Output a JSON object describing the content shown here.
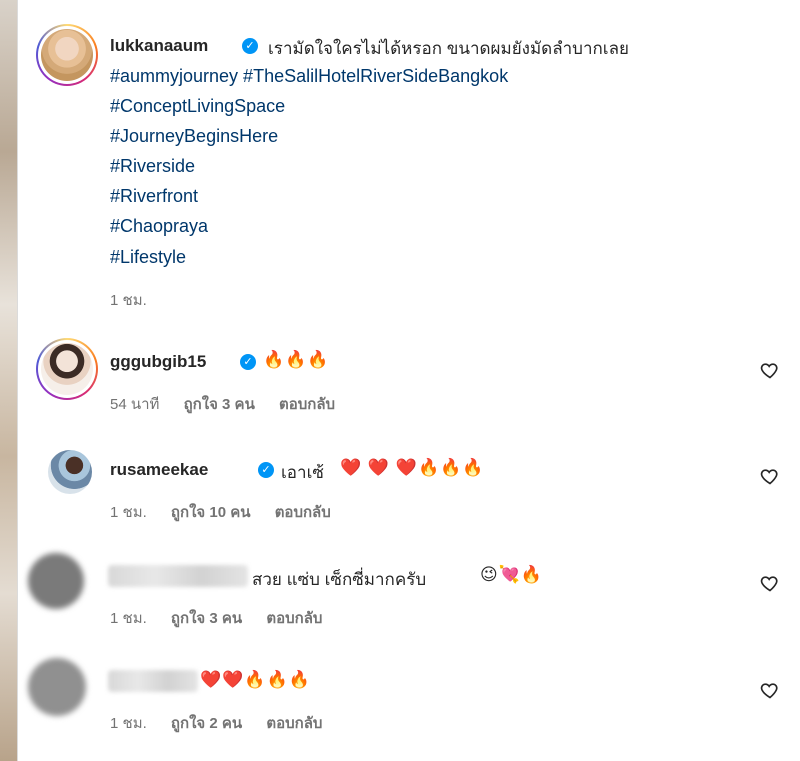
{
  "caption": {
    "username": "lukkanaaum",
    "text": "เรามัดใจใครไม่ได้หรอก ขนาดผมยังมัดลำบากเลย",
    "hashtags": [
      "#aummyjourney #TheSalilHotelRiverSideBangkok",
      "#ConceptLivingSpace",
      "#JourneyBeginsHere",
      "#Riverside",
      "#Riverfront",
      "#Chaopraya",
      "#Lifestyle"
    ],
    "time": "1 ชม."
  },
  "comments": [
    {
      "username": "gggubgib15",
      "text": "",
      "emoji": "🔥🔥🔥",
      "time": "54 นาที",
      "likes": "ถูกใจ 3 คน",
      "reply": "ตอบกลับ"
    },
    {
      "username": "rusameekae",
      "text": "เอาเซ้",
      "emoji": "❤️ ❤️ ❤️🔥🔥🔥",
      "time": "1 ชม.",
      "likes": "ถูกใจ 10 คน",
      "reply": "ตอบกลับ"
    },
    {
      "username": "",
      "text": "สวย แซ่บ เซ็กซี่มากครับ",
      "emoji": "😉💘🔥",
      "time": "1 ชม.",
      "likes": "ถูกใจ 3 คน",
      "reply": "ตอบกลับ"
    },
    {
      "username": "",
      "text": "",
      "emoji": "❤️❤️🔥🔥🔥",
      "time": "1 ชม.",
      "likes": "ถูกใจ 2 คน",
      "reply": "ตอบกลับ"
    }
  ],
  "icons": {
    "verified": "verified-badge-icon",
    "like": "heart-outline-icon"
  },
  "colors": {
    "hashtag": "#00376b",
    "verified": "#0095f6",
    "meta": "#737373"
  }
}
